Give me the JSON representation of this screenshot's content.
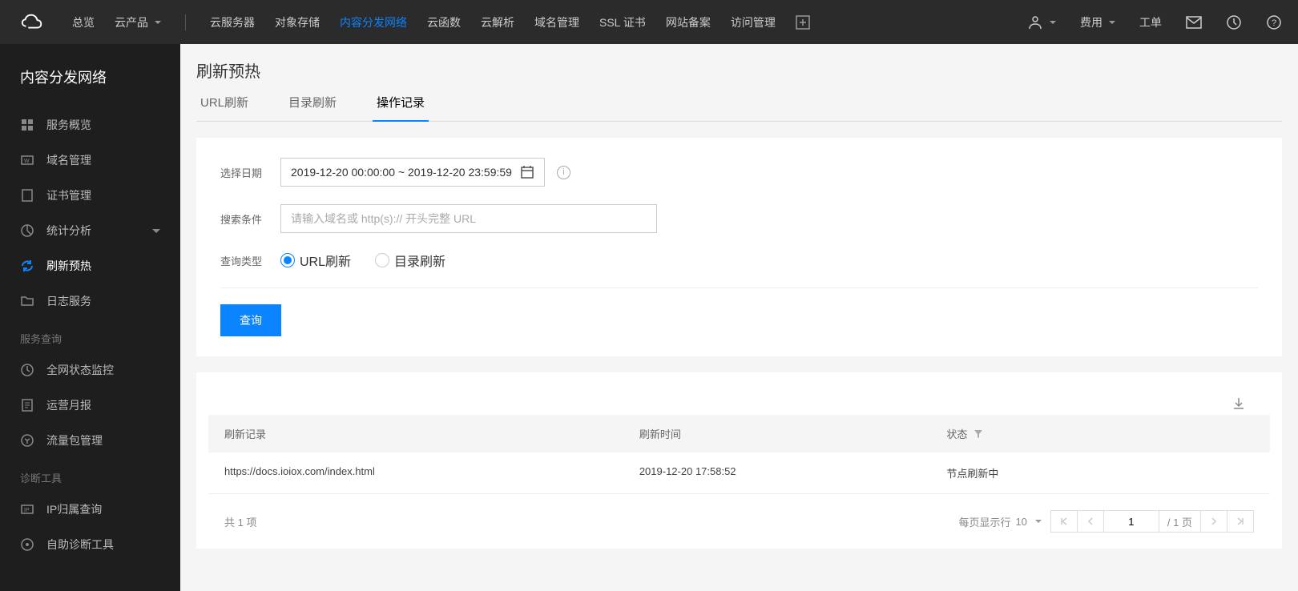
{
  "header": {
    "nav": {
      "overview": "总览",
      "products": "云产品",
      "cvm": "云服务器",
      "cos": "对象存储",
      "cdn": "内容分发网络",
      "scf": "云函数",
      "dns": "云解析",
      "domain": "域名管理",
      "ssl": "SSL 证书",
      "beian": "网站备案",
      "cam": "访问管理"
    },
    "right": {
      "fee": "费用",
      "ticket": "工单"
    }
  },
  "sidebar": {
    "title": "内容分发网络",
    "items": {
      "overview": "服务概览",
      "domain": "域名管理",
      "cert": "证书管理",
      "stats": "统计分析",
      "refresh": "刷新预热",
      "log": "日志服务"
    },
    "sections": {
      "query": "服务查询",
      "diag": "诊断工具"
    },
    "query_items": {
      "monitor": "全网状态监控",
      "report": "运营月报",
      "traffic": "流量包管理"
    },
    "diag_items": {
      "ip": "IP归属查询",
      "self": "自助诊断工具"
    }
  },
  "page": {
    "title": "刷新预热",
    "tabs": {
      "url": "URL刷新",
      "dir": "目录刷新",
      "log": "操作记录"
    },
    "form": {
      "date_label": "选择日期",
      "date_value": "2019-12-20 00:00:00 ~ 2019-12-20 23:59:59",
      "search_label": "搜索条件",
      "search_placeholder": "请输入域名或 http(s):// 开头完整 URL",
      "type_label": "查询类型",
      "type_url": "URL刷新",
      "type_dir": "目录刷新",
      "submit": "查询"
    },
    "table": {
      "headers": {
        "record": "刷新记录",
        "time": "刷新时间",
        "status": "状态"
      },
      "rows": [
        {
          "record": "https://docs.ioiox.com/index.html",
          "time": "2019-12-20 17:58:52",
          "status": "节点刷新中"
        }
      ],
      "footer": {
        "total_prefix": "共",
        "total_count": "1",
        "total_suffix": "项",
        "per_page": "每页显示行",
        "page_size": "10",
        "page_current": "1",
        "page_total": "/ 1 页"
      }
    }
  }
}
